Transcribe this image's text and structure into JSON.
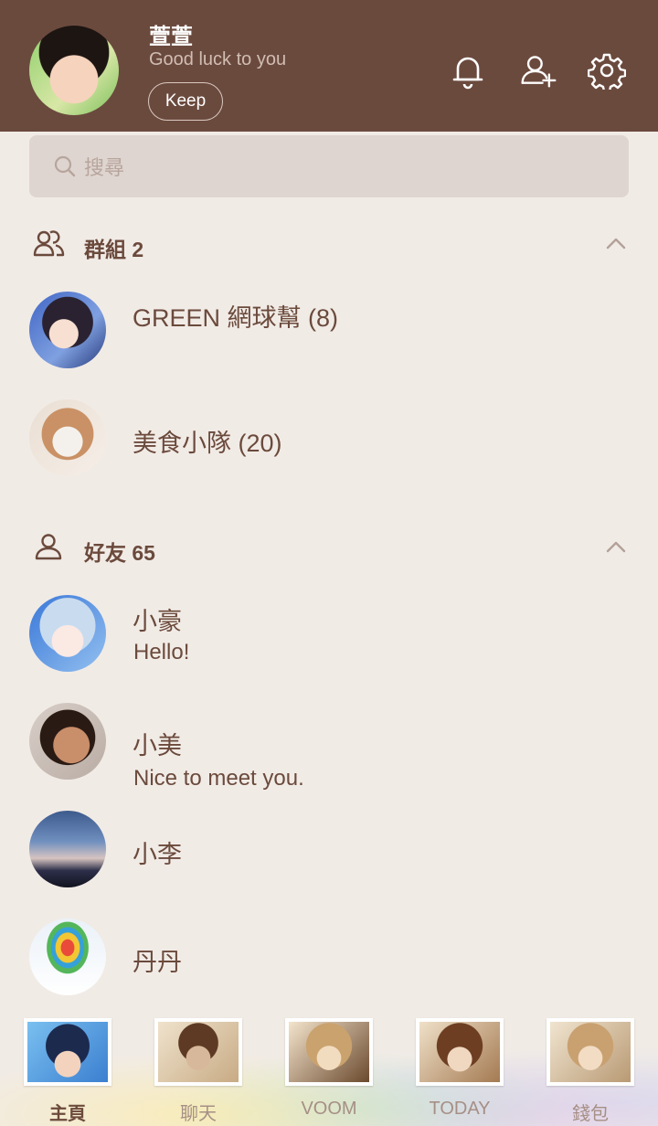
{
  "profile": {
    "name": "萱萱",
    "status": "Good luck to you",
    "keep_label": "Keep"
  },
  "header_icons": [
    "bell-icon",
    "add-friend-icon",
    "gear-icon"
  ],
  "search": {
    "placeholder": "搜尋"
  },
  "groups": {
    "label": "群組 2",
    "items": [
      {
        "name": "GREEN 網球幫 (8)"
      },
      {
        "name": "美食小隊 (20)"
      }
    ]
  },
  "friends": {
    "label": "好友 65",
    "items": [
      {
        "name": "小豪",
        "message": "Hello!"
      },
      {
        "name": "小美",
        "message": "Nice to meet you."
      },
      {
        "name": "小李"
      },
      {
        "name": "丹丹"
      }
    ]
  },
  "bottom_nav": {
    "tabs": [
      {
        "label": "主頁",
        "active": true
      },
      {
        "label": "聊天"
      },
      {
        "label": "VOOM"
      },
      {
        "label": "TODAY"
      },
      {
        "label": "錢包"
      }
    ]
  },
  "colors": {
    "header_bg": "#6b4a3e",
    "page_bg": "#f1ebe6",
    "text_brown": "#6b4a3c",
    "search_bg": "#dfd5d0"
  }
}
